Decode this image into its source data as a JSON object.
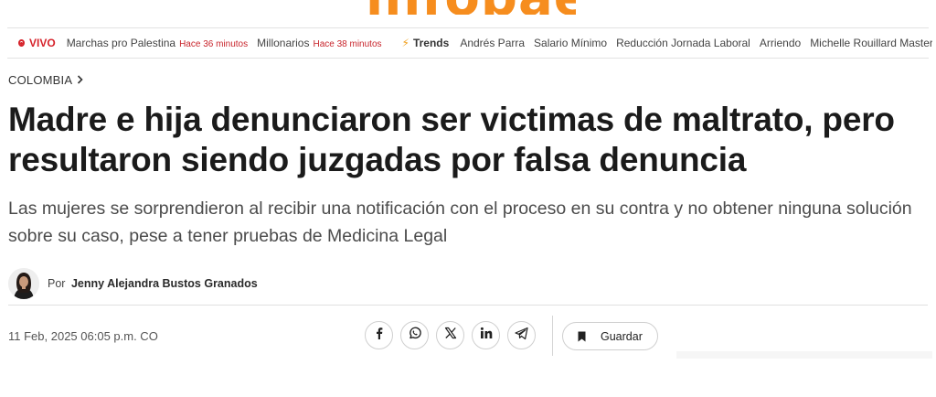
{
  "header": {
    "logo_text": "infobae"
  },
  "ticker": {
    "live_label": "VIVO",
    "items": [
      {
        "label": "Marchas pro Palestina",
        "time": "Hace 36 minutos"
      },
      {
        "label": "Millonarios",
        "time": "Hace 38 minutos"
      }
    ],
    "trends_label": "Trends",
    "trends": [
      "Andrés Parra",
      "Salario Mínimo",
      "Reducción Jornada Laboral",
      "Arriendo",
      "Michelle Rouillard MasterChef"
    ]
  },
  "article": {
    "section": "COLOMBIA",
    "headline": "Madre e hija denunciaron ser victimas de maltrato, pero resultaron siendo juzgadas por falsa denuncia",
    "subheadline": "Las mujeres se sorprendieron al recibir una notificación con el proceso en su contra y no obtener ninguna solución sobre su caso, pese a tener pruebas de Medicina Legal",
    "byline_prefix": "Por",
    "author": "Jenny Alejandra Bustos Granados",
    "date": "11 Feb, 2025 06:05 p.m. CO"
  },
  "share": {
    "icons": [
      "facebook-icon",
      "whatsapp-icon",
      "x-icon",
      "linkedin-icon",
      "telegram-icon"
    ],
    "save_label": "Guardar"
  },
  "colors": {
    "brand": "#f68d1e",
    "live": "#d6232b",
    "trend_bolt": "#f0a020"
  }
}
